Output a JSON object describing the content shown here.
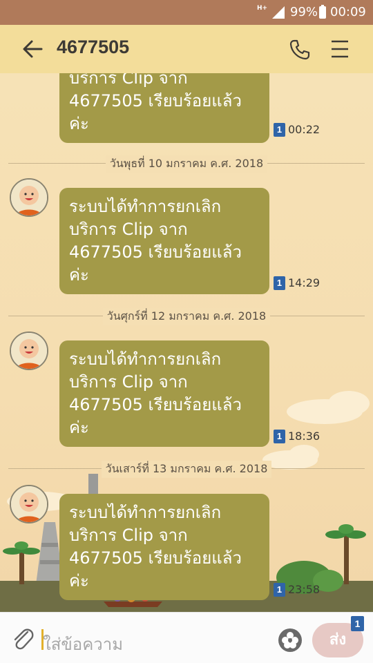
{
  "status_bar": {
    "network": "H+",
    "battery_percent": "99%",
    "time": "00:09"
  },
  "header": {
    "title": "4677505"
  },
  "messages": [
    {
      "lines": [
        "บริการ Clip จาก",
        "4677505 เรียบร้อยแล้ว",
        "ค่ะ"
      ],
      "sim": "1",
      "time": "00:22"
    },
    {
      "date": "วันพุธที่ 10 มกราคม ค.ศ. 2018",
      "lines": [
        "ระบบได้ทำการยกเลิก",
        "บริการ Clip จาก",
        "4677505 เรียบร้อยแล้ว",
        "ค่ะ"
      ],
      "sim": "1",
      "time": "14:29"
    },
    {
      "date": "วันศุกร์ที่ 12 มกราคม ค.ศ. 2018",
      "lines": [
        "ระบบได้ทำการยกเลิก",
        "บริการ Clip จาก",
        "4677505 เรียบร้อยแล้ว",
        "ค่ะ"
      ],
      "sim": "1",
      "time": "18:36"
    },
    {
      "date": "วันเสาร์ที่ 13 มกราคม ค.ศ. 2018",
      "lines": [
        "ระบบได้ทำการยกเลิก",
        "บริการ Clip จาก",
        "4677505 เรียบร้อยแล้ว",
        "ค่ะ"
      ],
      "sim": "1",
      "time": "23:58"
    }
  ],
  "input": {
    "placeholder": "ใส่ข้อความ",
    "send_label": "ส่ง",
    "send_sim": "1"
  },
  "colors": {
    "bubble": "#a39a48",
    "header": "#f3dd9a",
    "status_bar": "#b07a5a",
    "sim_badge": "#2f64a8"
  }
}
